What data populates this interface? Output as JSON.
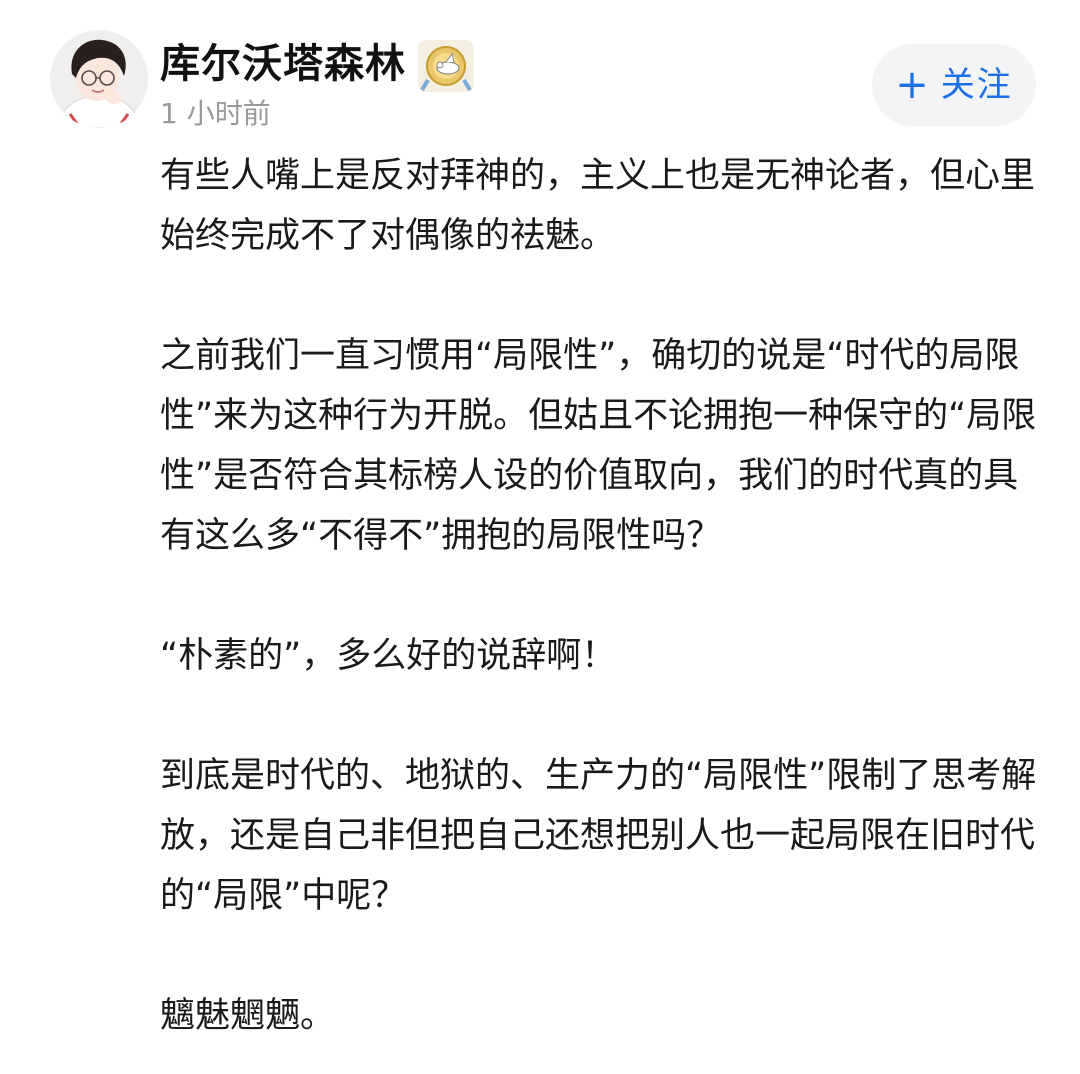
{
  "post": {
    "author": {
      "name": "库尔沃塔森林",
      "badge_icon": "gold-medal-badge-icon",
      "avatar_icon": "cartoon-avatar-icon"
    },
    "timestamp": "1 小时前",
    "follow_button": {
      "icon": "plus-icon",
      "plus": "+",
      "label": "关注",
      "color": "#1d6fe6"
    },
    "paragraphs": [
      "有些人嘴上是反对拜神的，主义上也是无神论者，但心里始终完成不了对偶像的祛魅。",
      "之前我们一直习惯用“局限性”，确切的说是“时代的局限性”来为这种行为开脱。但姑且不论拥抱一种保守的“局限性”是否符合其标榜人设的价值取向，我们的时代真的具有这么多“不得不”拥抱的局限性吗？",
      "“朴素的”，多么好的说辞啊！",
      "到底是时代的、地狱的、生产力的“局限性”限制了思考解放，还是自己非但把自己还想把别人也一起局限在旧时代的“局限”中呢？",
      "魑魅魍魉。"
    ]
  }
}
